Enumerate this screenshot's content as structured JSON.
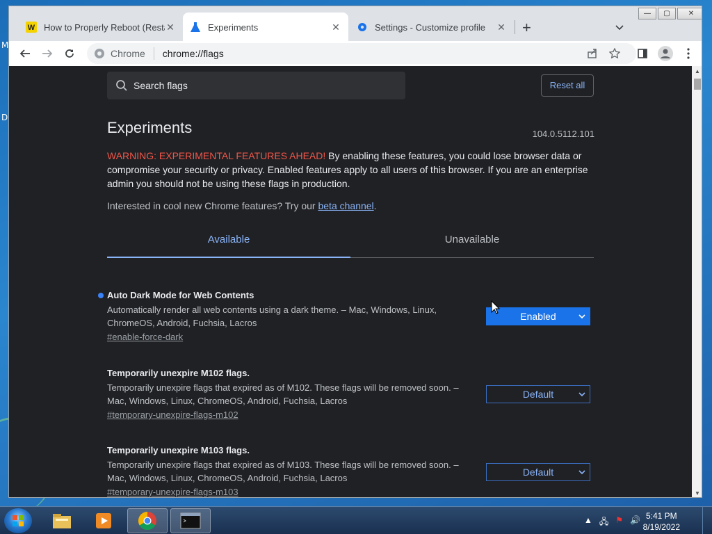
{
  "desktop": {
    "letters": [
      "M",
      "D"
    ]
  },
  "window": {
    "tabs": [
      {
        "title": "How to Properly Reboot (Restart)",
        "icon": "wikihow-icon",
        "active": false
      },
      {
        "title": "Experiments",
        "icon": "flask-icon",
        "active": true
      },
      {
        "title": "Settings - Customize profile",
        "icon": "gear-icon",
        "active": false
      }
    ],
    "new_tab": "+",
    "controls": {
      "minimize": "—",
      "maximize": "▢",
      "close": "✕"
    }
  },
  "omnibox": {
    "scheme": "Chrome",
    "url": "chrome://flags"
  },
  "page": {
    "search_placeholder": "Search flags",
    "reset_label": "Reset all",
    "title": "Experiments",
    "version": "104.0.5112.101",
    "warning_prefix": "WARNING: EXPERIMENTAL FEATURES AHEAD!",
    "warning_text": " By enabling these features, you could lose browser data or compromise your security or privacy. Enabled features apply to all users of this browser. If you are an enterprise admin you should not be using these flags in production.",
    "interest_text": "Interested in cool new Chrome features? Try our ",
    "interest_link": "beta channel",
    "interest_end": ".",
    "tabs": {
      "available": "Available",
      "unavailable": "Unavailable"
    },
    "flags": [
      {
        "name": "Auto Dark Mode for Web Contents",
        "description": "Automatically render all web contents using a dark theme. – Mac, Windows, Linux, ChromeOS, Android, Fuchsia, Lacros",
        "link": "#enable-force-dark",
        "value": "Enabled",
        "modified": true
      },
      {
        "name": "Temporarily unexpire M102 flags.",
        "description": "Temporarily unexpire flags that expired as of M102. These flags will be removed soon. – Mac, Windows, Linux, ChromeOS, Android, Fuchsia, Lacros",
        "link": "#temporary-unexpire-flags-m102",
        "value": "Default",
        "modified": false
      },
      {
        "name": "Temporarily unexpire M103 flags.",
        "description": "Temporarily unexpire flags that expired as of M103. These flags will be removed soon. – Mac, Windows, Linux, ChromeOS, Android, Fuchsia, Lacros",
        "link": "#temporary-unexpire-flags-m103",
        "value": "Default",
        "modified": false
      }
    ]
  },
  "taskbar": {
    "items": [
      "explorer-icon",
      "media-player-icon",
      "chrome-icon",
      "cmd-icon"
    ],
    "time": "5:41 PM",
    "date": "8/19/2022"
  },
  "colors": {
    "accent": "#8ab4f8",
    "warning": "#f2564a",
    "page_bg": "#202124",
    "enabled": "#1a73e8"
  }
}
